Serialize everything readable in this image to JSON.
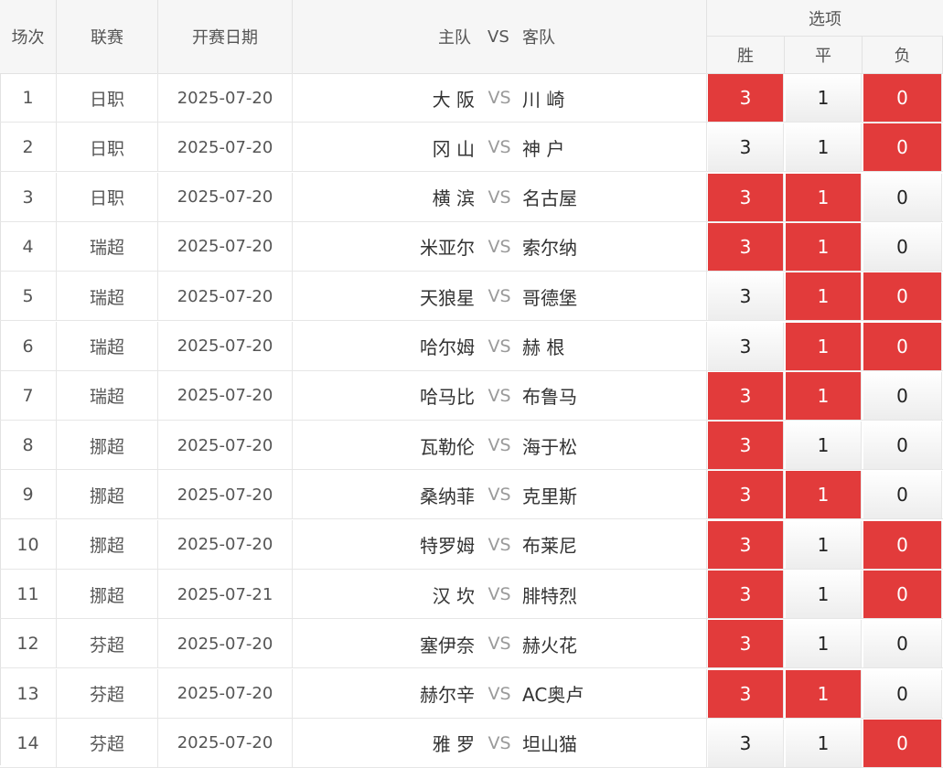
{
  "header": {
    "col_no": "场次",
    "col_league": "联赛",
    "col_date": "开赛日期",
    "col_home": "主队",
    "col_vs": "VS",
    "col_away": "客队",
    "col_options": "选项",
    "opt_win": "胜",
    "opt_draw": "平",
    "opt_lose": "负"
  },
  "colors": {
    "selected": "#e23b3b",
    "vs_text": "#9a9a9a"
  },
  "rows": [
    {
      "no": "1",
      "league": "日职",
      "date": "2025-07-20",
      "home": "大 阪",
      "vs": "VS",
      "away": "川 崎",
      "win": "3",
      "draw": "1",
      "lose": "0",
      "sel": [
        true,
        false,
        true
      ]
    },
    {
      "no": "2",
      "league": "日职",
      "date": "2025-07-20",
      "home": "冈 山",
      "vs": "VS",
      "away": "神 户",
      "win": "3",
      "draw": "1",
      "lose": "0",
      "sel": [
        false,
        false,
        true
      ]
    },
    {
      "no": "3",
      "league": "日职",
      "date": "2025-07-20",
      "home": "横 滨",
      "vs": "VS",
      "away": "名古屋",
      "win": "3",
      "draw": "1",
      "lose": "0",
      "sel": [
        true,
        true,
        false
      ]
    },
    {
      "no": "4",
      "league": "瑞超",
      "date": "2025-07-20",
      "home": "米亚尔",
      "vs": "VS",
      "away": "索尔纳",
      "win": "3",
      "draw": "1",
      "lose": "0",
      "sel": [
        true,
        true,
        false
      ]
    },
    {
      "no": "5",
      "league": "瑞超",
      "date": "2025-07-20",
      "home": "天狼星",
      "vs": "VS",
      "away": "哥德堡",
      "win": "3",
      "draw": "1",
      "lose": "0",
      "sel": [
        false,
        true,
        true
      ]
    },
    {
      "no": "6",
      "league": "瑞超",
      "date": "2025-07-20",
      "home": "哈尔姆",
      "vs": "VS",
      "away": "赫 根",
      "win": "3",
      "draw": "1",
      "lose": "0",
      "sel": [
        false,
        true,
        true
      ]
    },
    {
      "no": "7",
      "league": "瑞超",
      "date": "2025-07-20",
      "home": "哈马比",
      "vs": "VS",
      "away": "布鲁马",
      "win": "3",
      "draw": "1",
      "lose": "0",
      "sel": [
        true,
        true,
        false
      ]
    },
    {
      "no": "8",
      "league": "挪超",
      "date": "2025-07-20",
      "home": "瓦勒伦",
      "vs": "VS",
      "away": "海于松",
      "win": "3",
      "draw": "1",
      "lose": "0",
      "sel": [
        true,
        false,
        false
      ]
    },
    {
      "no": "9",
      "league": "挪超",
      "date": "2025-07-20",
      "home": "桑纳菲",
      "vs": "VS",
      "away": "克里斯",
      "win": "3",
      "draw": "1",
      "lose": "0",
      "sel": [
        true,
        true,
        false
      ]
    },
    {
      "no": "10",
      "league": "挪超",
      "date": "2025-07-20",
      "home": "特罗姆",
      "vs": "VS",
      "away": "布莱尼",
      "win": "3",
      "draw": "1",
      "lose": "0",
      "sel": [
        true,
        false,
        true
      ]
    },
    {
      "no": "11",
      "league": "挪超",
      "date": "2025-07-21",
      "home": "汉 坎",
      "vs": "VS",
      "away": "腓特烈",
      "win": "3",
      "draw": "1",
      "lose": "0",
      "sel": [
        true,
        false,
        true
      ]
    },
    {
      "no": "12",
      "league": "芬超",
      "date": "2025-07-20",
      "home": "塞伊奈",
      "vs": "VS",
      "away": "赫火花",
      "win": "3",
      "draw": "1",
      "lose": "0",
      "sel": [
        true,
        false,
        false
      ]
    },
    {
      "no": "13",
      "league": "芬超",
      "date": "2025-07-20",
      "home": "赫尔辛",
      "vs": "VS",
      "away": "AC奥卢",
      "win": "3",
      "draw": "1",
      "lose": "0",
      "sel": [
        true,
        true,
        false
      ]
    },
    {
      "no": "14",
      "league": "芬超",
      "date": "2025-07-20",
      "home": "雅 罗",
      "vs": "VS",
      "away": "坦山猫",
      "win": "3",
      "draw": "1",
      "lose": "0",
      "sel": [
        false,
        false,
        true
      ]
    }
  ]
}
